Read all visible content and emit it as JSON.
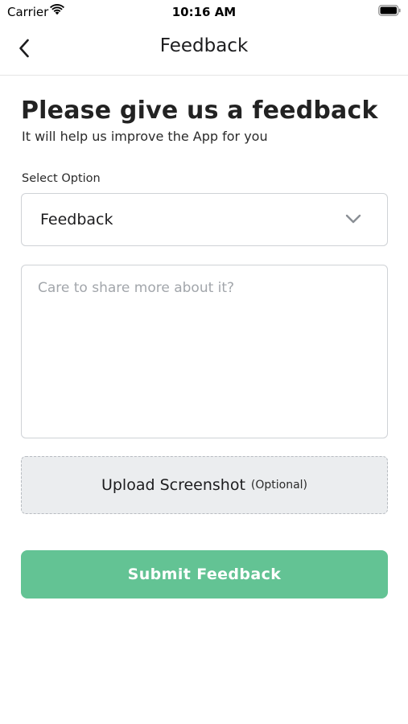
{
  "status_bar": {
    "carrier": "Carrier",
    "time": "10:16 AM",
    "wifi_icon": "wifi-icon",
    "battery_icon": "battery-full-icon"
  },
  "nav": {
    "title": "Feedback",
    "back_icon": "chevron-left-icon"
  },
  "form": {
    "heading": "Please give us a feedback",
    "subheading": "It will help us improve the App for you",
    "select_label": "Select Option",
    "select_value": "Feedback",
    "textarea_placeholder": "Care to share more about it?",
    "textarea_value": "",
    "upload_label": "Upload Screenshot",
    "upload_optional": "(Optional)",
    "submit_label": "Submit Feedback"
  },
  "colors": {
    "accent": "#63c394",
    "border": "#cfd2d6",
    "upload_bg": "#ebedef",
    "placeholder": "#a2a6ab"
  }
}
